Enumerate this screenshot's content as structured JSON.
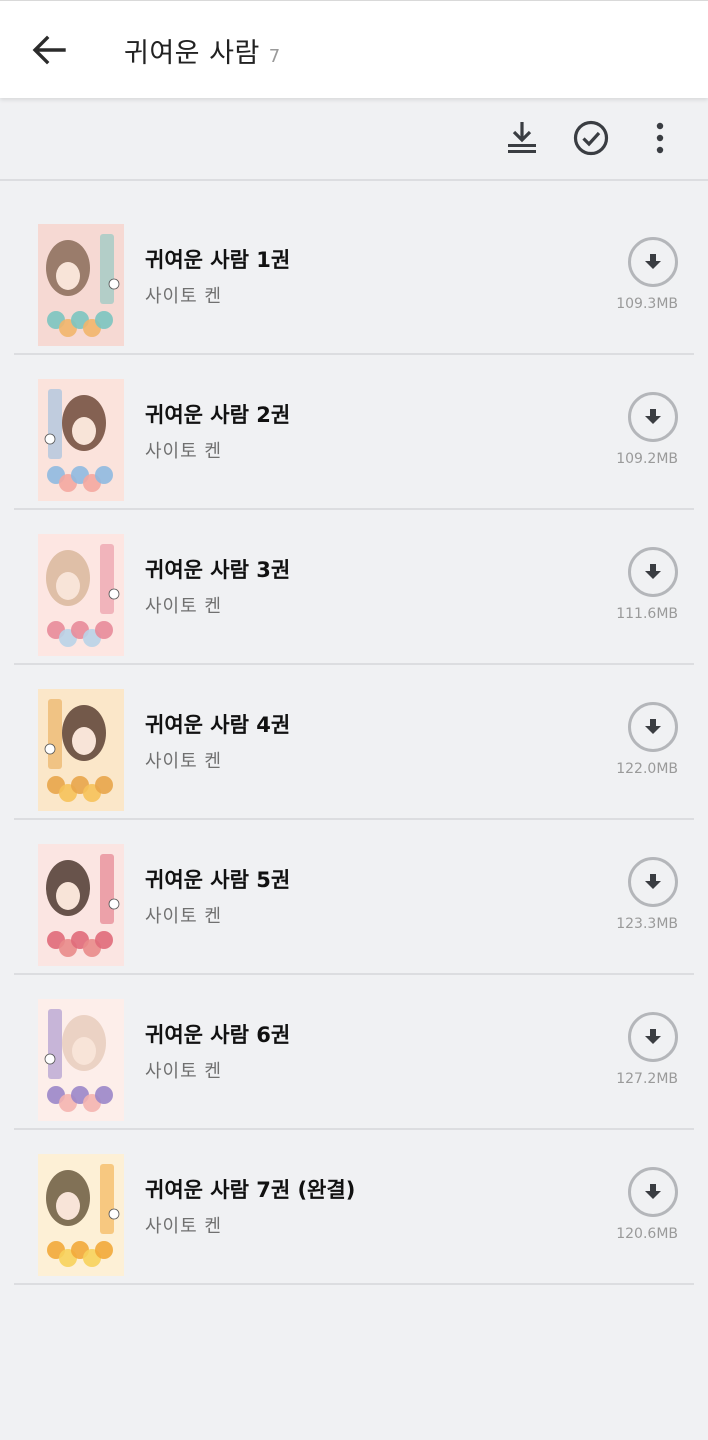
{
  "header": {
    "title": "귀여운 사람",
    "count": "7",
    "back_icon": "arrow-left-icon"
  },
  "toolbar": {
    "download_all_icon": "download-all-icon",
    "select_icon": "check-circle-icon",
    "more_icon": "more-vertical-icon"
  },
  "items": [
    {
      "title": "귀여운 사람 1권",
      "author": "사이토 켄",
      "size": "109.3MB",
      "volume": "1",
      "cover_colors": [
        "#f6d9d3",
        "#8a6b58",
        "#f2b56b",
        "#7cc4c0"
      ]
    },
    {
      "title": "귀여운 사람 2권",
      "author": "사이토 켄",
      "size": "109.2MB",
      "volume": "2",
      "cover_colors": [
        "#fbe3dc",
        "#6e4a3a",
        "#f4a7a0",
        "#8fb9e0"
      ]
    },
    {
      "title": "귀여운 사람 3권",
      "author": "사이토 켄",
      "size": "111.6MB",
      "volume": "3",
      "cover_colors": [
        "#fde6e2",
        "#d9b79c",
        "#b9d3e8",
        "#e88b9a"
      ]
    },
    {
      "title": "귀여운 사람 4권",
      "author": "사이토 켄",
      "size": "122.0MB",
      "volume": "4",
      "cover_colors": [
        "#fbe7c9",
        "#5a4034",
        "#f6c25a",
        "#e8a54a"
      ]
    },
    {
      "title": "귀여운 사람 5권",
      "author": "사이토 켄",
      "size": "123.3MB",
      "volume": "5",
      "cover_colors": [
        "#fbe5e2",
        "#4e3a30",
        "#e98b8b",
        "#e06a7a"
      ]
    },
    {
      "title": "귀여운 사람 6권",
      "author": "사이토 켄",
      "size": "127.2MB",
      "volume": "6",
      "cover_colors": [
        "#fdeeea",
        "#e8cdbd",
        "#f4b4b0",
        "#9b86c9"
      ]
    },
    {
      "title": "귀여운 사람 7권 (완결)",
      "author": "사이토 켄",
      "size": "120.6MB",
      "volume": "7",
      "cover_colors": [
        "#fdf0d6",
        "#6b5a40",
        "#f7d25c",
        "#f2a83a"
      ]
    }
  ],
  "colors": {
    "background": "#f0f1f3",
    "appbar": "#ffffff",
    "icon_dark": "#3a3d42",
    "download_circle": "#b4b6ba",
    "size_text": "#9a9a9a"
  }
}
